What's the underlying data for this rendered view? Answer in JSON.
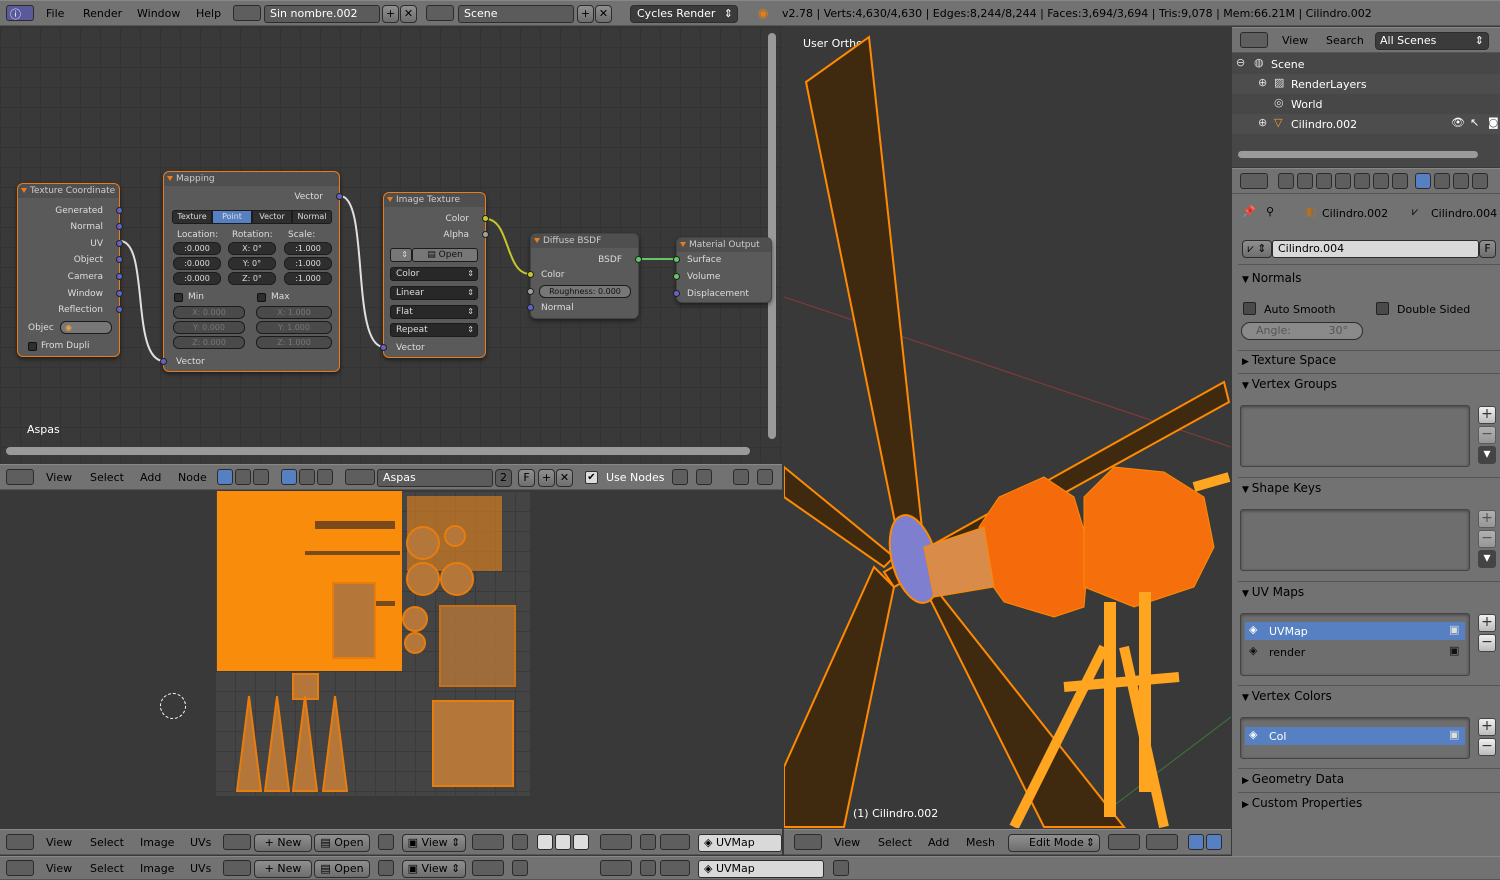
{
  "top_bar": {
    "menus": [
      "File",
      "Render",
      "Window",
      "Help"
    ],
    "screen_name": "Sin nombre.002",
    "scene_name": "Scene",
    "engine": "Cycles Render",
    "stats": "v2.78 | Verts:4,630/4,630 | Edges:8,244/8,244 | Faces:3,694/3,694 | Tris:9,078 | Mem:66.21M | Cilindro.002"
  },
  "node_editor": {
    "material_label": "Aspas",
    "header": {
      "menus": [
        "View",
        "Select",
        "Add",
        "Node"
      ],
      "material_name": "Aspas",
      "users": "2",
      "fake_user": "F",
      "use_nodes_label": "Use Nodes"
    },
    "nodes": {
      "texcoord": {
        "title": "Texture Coordinate",
        "outputs": [
          "Generated",
          "Normal",
          "UV",
          "Object",
          "Camera",
          "Window",
          "Reflection"
        ],
        "object_label": "Objec",
        "from_dupli": "From Dupli"
      },
      "mapping": {
        "title": "Mapping",
        "output": "Vector",
        "tabs": [
          "Texture",
          "Point",
          "Vector",
          "Normal"
        ],
        "active_tab": "Point",
        "col_labels": [
          "Location:",
          "Rotation:",
          "Scale:"
        ],
        "location": [
          ":0.000",
          ":0.000",
          ":0.000"
        ],
        "rotation": [
          "X:   0°",
          "Y:   0°",
          "Z:   0°"
        ],
        "scale": [
          ":1.000",
          ":1.000",
          ":1.000"
        ],
        "min_label": "Min",
        "max_label": "Max",
        "min_vals": [
          "X:     0.000",
          "Y:     0.000",
          "Z:     0.000"
        ],
        "max_vals": [
          "X:     1.000",
          "Y:     1.000",
          "Z:     1.000"
        ],
        "input": "Vector"
      },
      "image_texture": {
        "title": "Image Texture",
        "outputs": [
          "Color",
          "Alpha"
        ],
        "open_label": "Open",
        "selects": [
          "Color",
          "Linear",
          "Flat",
          "Repeat"
        ],
        "input": "Vector"
      },
      "diffuse": {
        "title": "Diffuse BSDF",
        "output": "BSDF",
        "inputs": [
          "Color",
          "Normal"
        ],
        "roughness": "Roughness:   0.000"
      },
      "output": {
        "title": "Material Output",
        "inputs": [
          "Surface",
          "Volume",
          "Displacement"
        ]
      }
    }
  },
  "viewport": {
    "view_label": "User Ortho",
    "object_label": "(1) Cilindro.002",
    "header": {
      "menus": [
        "View",
        "Select",
        "Add",
        "Mesh"
      ],
      "mode": "Edit Mode"
    }
  },
  "uv_editor": {
    "header1": {
      "menus": [
        "View",
        "Select",
        "Image",
        "UVs"
      ],
      "new_label": "New",
      "open_label": "Open",
      "view_label": "View",
      "uvmap": "UVMap"
    },
    "header2": {
      "menus": [
        "View",
        "Select",
        "Image",
        "UVs"
      ],
      "new_label": "New",
      "open_label": "Open",
      "view_label": "View",
      "uvmap": "UVMap"
    }
  },
  "outliner": {
    "menus": [
      "View",
      "Search"
    ],
    "filter": "All Scenes",
    "items": [
      "Scene",
      "RenderLayers",
      "World",
      "Cilindro.002"
    ]
  },
  "properties": {
    "breadcrumb": [
      "Cilindro.002",
      "Cilindro.004"
    ],
    "mesh_name": "Cilindro.004",
    "fake": "F",
    "panels": {
      "normals": "Normals",
      "auto_smooth": "Auto Smooth",
      "double_sided": "Double Sided",
      "angle": "Angle:",
      "angle_value": "30°",
      "texture_space": "Texture Space",
      "vertex_groups": "Vertex Groups",
      "shape_keys": "Shape Keys",
      "uv_maps": "UV Maps",
      "uv_list": [
        "UVMap",
        "render"
      ],
      "vertex_colors": "Vertex Colors",
      "vc_list": [
        "Col"
      ],
      "geometry_data": "Geometry Data",
      "custom_properties": "Custom Properties"
    }
  }
}
